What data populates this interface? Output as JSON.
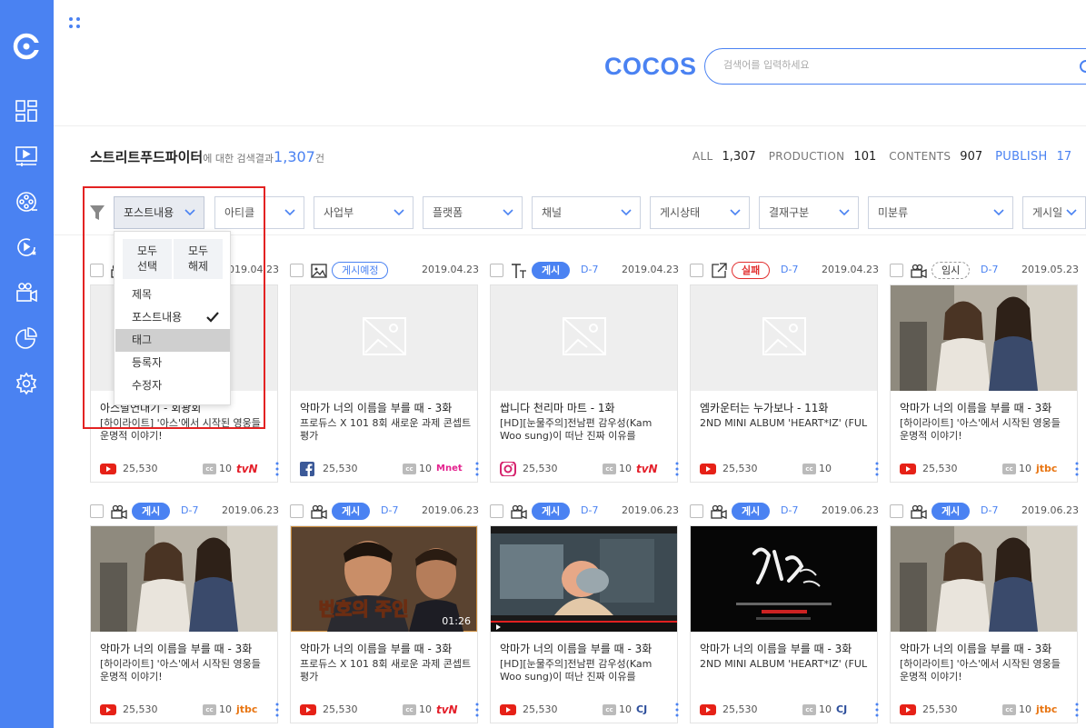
{
  "brand": "COCOS",
  "search": {
    "placeholder": "검색어를 입력하세요"
  },
  "result": {
    "keyword": "스트리트푸드파이터",
    "suffix": "에 대한 검색결과",
    "count": "1,307",
    "unit": "건"
  },
  "stats": [
    {
      "label": "ALL",
      "value": "1,307",
      "active": false
    },
    {
      "label": "PRODUCTION",
      "value": "101",
      "active": false
    },
    {
      "label": "CONTENTS",
      "value": "907",
      "active": false
    },
    {
      "label": "PUBLISH",
      "value": "17",
      "active": true
    }
  ],
  "filters": [
    {
      "label": "포스트내용",
      "active": true
    },
    {
      "label": "아티클",
      "active": false
    },
    {
      "label": "사업부",
      "active": false
    },
    {
      "label": "플랫폼",
      "active": false
    },
    {
      "label": "채널",
      "active": false
    },
    {
      "label": "게시상태",
      "active": false
    },
    {
      "label": "결재구분",
      "active": false
    },
    {
      "label": "미분류",
      "active": false
    },
    {
      "label": "게시일",
      "active": false
    }
  ],
  "dropdown": {
    "select_all": "모두\n선택",
    "deselect_all": "모두\n해제",
    "items": [
      {
        "label": "제목",
        "checked": false,
        "highlighted": false
      },
      {
        "label": "포스트내용",
        "checked": true,
        "highlighted": false
      },
      {
        "label": "태그",
        "checked": false,
        "highlighted": true
      },
      {
        "label": "등록자",
        "checked": false,
        "highlighted": false
      },
      {
        "label": "수정자",
        "checked": false,
        "highlighted": false
      }
    ]
  },
  "cards": [
    {
      "type": "video",
      "badge": "",
      "dday": "",
      "date": "2019.04.23",
      "thumb": "placeholder",
      "title": "아스달연대기 - 회광회",
      "desc": "[하이라이트] '아스'에서 시작된 영웅들 운명적 이야기!",
      "platform": "youtube",
      "views": "25,530",
      "cc": "10",
      "channel": "tvN"
    },
    {
      "type": "image",
      "badge": "게시예정",
      "badge_style": "outline",
      "dday": "",
      "date": "2019.04.23",
      "thumb": "placeholder",
      "title": "악마가 너의 이름을 부를 때 - 3화",
      "desc": "프로듀스 X 101 8회 새로운 과제 콘셉트 평가",
      "platform": "facebook",
      "views": "25,530",
      "cc": "10",
      "channel": "Mnet"
    },
    {
      "type": "text",
      "badge": "게시",
      "badge_style": "solid",
      "dday": "D-7",
      "date": "2019.04.23",
      "thumb": "placeholder",
      "title": "쌉니다 천리마 마트 - 1화",
      "desc": "[HD][눈물주의]전남편 감우성(Kam Woo sung)이 떠난 진짜 이유를",
      "platform": "instagram",
      "views": "25,530",
      "cc": "10",
      "channel": "tvN"
    },
    {
      "type": "link",
      "badge": "실패",
      "badge_style": "fail",
      "dday": "D-7",
      "date": "2019.04.23",
      "thumb": "placeholder",
      "title": "엠카운터는 누가보나 - 11화",
      "desc": "2ND MINI ALBUM 'HEART*IZ' (FUL",
      "platform": "youtube",
      "views": "25,530",
      "cc": "10",
      "channel": ""
    },
    {
      "type": "video",
      "badge": "임시",
      "badge_style": "temp",
      "dday": "D-7",
      "date": "2019.05.23",
      "thumb": "photo",
      "title": "악마가 너의 이름을 부를 때 - 3화",
      "desc": "[하이라이트] '아스'에서 시작된 영웅들 운명적 이야기!",
      "platform": "youtube",
      "views": "25,530",
      "cc": "10",
      "channel": "jtbc"
    },
    {
      "type": "video",
      "badge": "게시",
      "badge_style": "solid",
      "dday": "D-7",
      "date": "2019.06.23",
      "thumb": "photo",
      "title": "악마가 너의 이름을 부를 때 - 3화",
      "desc": "[하이라이트] '아스'에서 시작된 영웅들 운명적 이야기!",
      "platform": "youtube",
      "views": "25,530",
      "cc": "10",
      "channel": "jtbc"
    },
    {
      "type": "video",
      "badge": "게시",
      "badge_style": "solid",
      "dday": "D-7",
      "date": "2019.06.23",
      "thumb": "drama",
      "thumb_caption": "번호의 주인",
      "thumb_time": "01:26",
      "title": "악마가 너의 이름을 부를 때 - 3화",
      "desc": "프로듀스 X 101 8회 새로운 과제 콘셉트 평가",
      "platform": "youtube",
      "views": "25,530",
      "cc": "10",
      "channel": "tvN"
    },
    {
      "type": "video",
      "badge": "게시",
      "badge_style": "solid",
      "dday": "D-7",
      "date": "2019.06.23",
      "thumb": "player",
      "title": "악마가 너의 이름을 부를 때 - 3화",
      "desc": "[HD][눈물주의]전남편 감우성(Kam Woo sung)이 떠난 진짜 이유를",
      "platform": "youtube",
      "views": "25,530",
      "cc": "10",
      "channel": "CJ"
    },
    {
      "type": "video",
      "badge": "게시",
      "badge_style": "solid",
      "dday": "D-7",
      "date": "2019.06.23",
      "thumb": "poster",
      "title": "악마가 너의 이름을 부를 때 - 3화",
      "desc": "2ND MINI ALBUM 'HEART*IZ' (FUL",
      "platform": "youtube",
      "views": "25,530",
      "cc": "10",
      "channel": "CJ"
    },
    {
      "type": "video",
      "badge": "게시",
      "badge_style": "solid",
      "dday": "D-7",
      "date": "2019.06.23",
      "thumb": "photo",
      "title": "악마가 너의 이름을 부를 때 - 3화",
      "desc": "[하이라이트] '아스'에서 시작된 영웅들 운명적 이야기!",
      "platform": "youtube",
      "views": "25,530",
      "cc": "10",
      "channel": "jtbc"
    }
  ],
  "colors": {
    "accent": "#4a82f2",
    "fail": "#e23030",
    "highlight_box": "#e32222"
  }
}
